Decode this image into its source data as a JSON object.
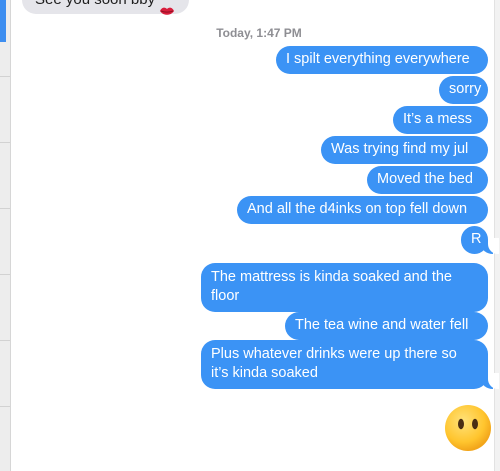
{
  "thread": {
    "incoming_partial": {
      "text": "See you soon bby"
    },
    "timestamp": "Today, 1:47 PM",
    "outgoing": [
      "I spilt everything everywhere",
      "sorry",
      "It’s a mess",
      "Was trying find my jul",
      "Moved the bed",
      "And all the d4inks on top fell down",
      "R",
      "The mattress is kinda soaked and  the floor",
      "The tea wine and  water fell",
      "Plus whatever drinks were up there so it’s kinda soaked"
    ],
    "emoji": "face-without-mouth"
  },
  "colors": {
    "outgoing_bubble": "#3b93f5",
    "incoming_bubble": "#e5e5ea",
    "timestamp_text": "#8e8e93",
    "sidebar_accent": "#3d8ef0"
  }
}
